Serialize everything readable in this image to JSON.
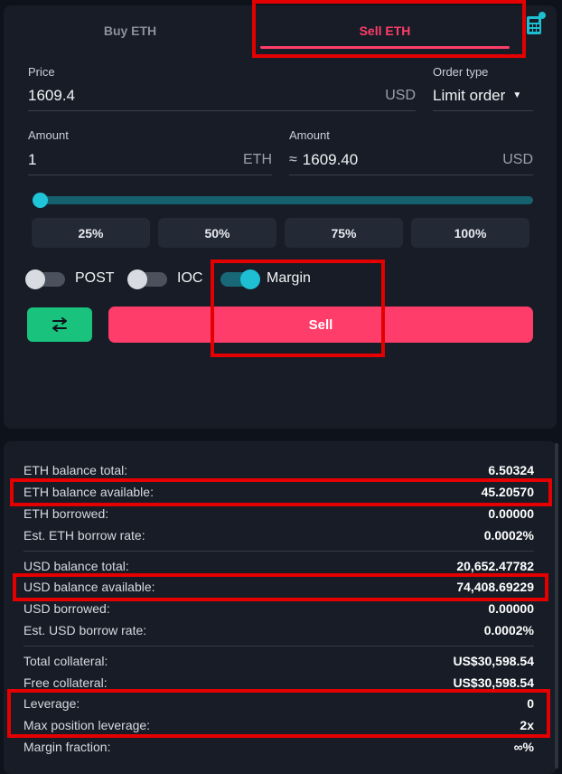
{
  "tabs": {
    "buy": "Buy ETH",
    "sell": "Sell ETH"
  },
  "price": {
    "label": "Price",
    "value": "1609.4",
    "unit": "USD"
  },
  "order_type": {
    "label": "Order type",
    "value": "Limit order"
  },
  "amount_eth": {
    "label": "Amount",
    "value": "1",
    "unit": "ETH"
  },
  "amount_usd": {
    "label": "Amount",
    "approx": "≈",
    "value": "1609.40",
    "unit": "USD"
  },
  "slider": {
    "value_fraction": 0.0
  },
  "percent_buttons": [
    "25%",
    "50%",
    "75%",
    "100%"
  ],
  "toggles": {
    "post": {
      "label": "POST",
      "on": false
    },
    "ioc": {
      "label": "IOC",
      "on": false
    },
    "margin": {
      "label": "Margin",
      "on": true
    }
  },
  "sell_button": "Sell",
  "balances": [
    {
      "label": "ETH balance total:",
      "value": "6.50324"
    },
    {
      "label": "ETH balance available:",
      "value": "45.20570"
    },
    {
      "label": "ETH borrowed:",
      "value": "0.00000"
    },
    {
      "label": "Est. ETH borrow rate:",
      "value": "0.0002%"
    },
    {
      "label": "USD balance total:",
      "value": "20,652.47782"
    },
    {
      "label": "USD balance available:",
      "value": "74,408.69229"
    },
    {
      "label": "USD borrowed:",
      "value": "0.00000"
    },
    {
      "label": "Est. USD borrow rate:",
      "value": "0.0002%"
    },
    {
      "label": "Total collateral:",
      "value": "US$30,598.54"
    },
    {
      "label": "Free collateral:",
      "value": "US$30,598.54"
    },
    {
      "label": "Leverage:",
      "value": "0"
    },
    {
      "label": "Max position leverage:",
      "value": "2x"
    },
    {
      "label": "Margin fraction:",
      "value": "∞%"
    }
  ],
  "colors": {
    "accent_sell": "#ff3d6a",
    "accent_teal": "#1fbfd3",
    "swap_green": "#19c37d",
    "highlight_red": "#e40000"
  }
}
